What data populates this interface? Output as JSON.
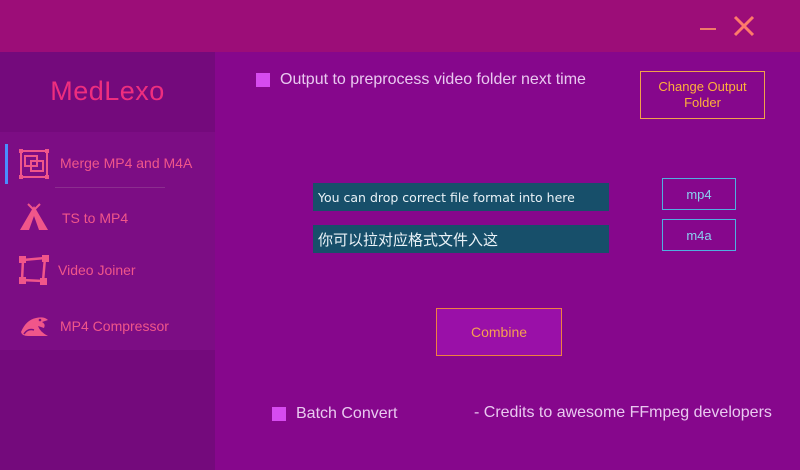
{
  "titlebar": {
    "min_icon": "minimize-icon",
    "close_icon": "close-icon"
  },
  "sidebar": {
    "logo": "MedLexo",
    "items": [
      {
        "label": "Merge MP4 and M4A",
        "icon": "merge-windows-icon",
        "active": true
      },
      {
        "label": "TS to MP4",
        "icon": "tent-icon",
        "active": false
      },
      {
        "label": "Video Joiner",
        "icon": "frame-crop-icon",
        "active": false
      },
      {
        "label": "MP4 Compressor",
        "icon": "dragon-icon",
        "active": false
      }
    ]
  },
  "main": {
    "output_checkbox_label": "Output to preprocess video folder next time",
    "change_output_button": "Change Output Folder",
    "drop_hint_en": "You can drop correct file format into here",
    "drop_hint_cn": "你可以拉对应格式文件入这",
    "mp4_button": "mp4",
    "m4a_button": "m4a",
    "combine_button": "Combine",
    "batch_convert_label": "Batch Convert",
    "credits": "- Credits to awesome FFmpeg developers"
  },
  "colors": {
    "background": "#86078c",
    "titlebar": "#9c0d78",
    "sidebar": "#740a7c",
    "accent_orange": "#ffb13a",
    "accent_pink": "#ee2e7e",
    "drop_box": "#174f6a"
  }
}
